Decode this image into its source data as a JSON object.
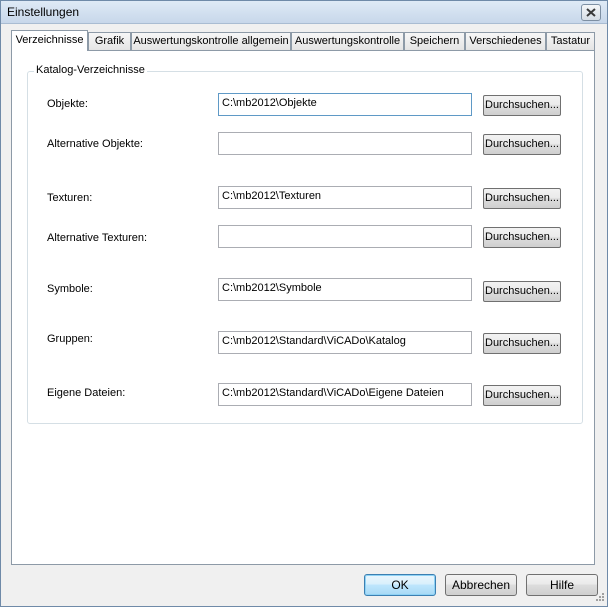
{
  "window": {
    "title": "Einstellungen"
  },
  "tabs": [
    {
      "label": "Verzeichnisse",
      "active": true
    },
    {
      "label": "Grafik",
      "active": false
    },
    {
      "label": "Auswertungskontrolle allgemein",
      "active": false
    },
    {
      "label": "Auswertungskontrolle",
      "active": false
    },
    {
      "label": "Speichern",
      "active": false
    },
    {
      "label": "Verschiedenes",
      "active": false
    },
    {
      "label": "Tastatur",
      "active": false
    }
  ],
  "group": {
    "title": "Katalog-Verzeichnisse",
    "rows": [
      {
        "label": "Objekte:",
        "value": "C:\\mb2012\\Objekte",
        "button": "Durchsuchen..."
      },
      {
        "label": "Alternative Objekte:",
        "value": "",
        "button": "Durchsuchen..."
      },
      {
        "label": "Texturen:",
        "value": "C:\\mb2012\\Texturen",
        "button": "Durchsuchen..."
      },
      {
        "label": "Alternative Texturen:",
        "value": "",
        "button": "Durchsuchen..."
      },
      {
        "label": "Symbole:",
        "value": "C:\\mb2012\\Symbole",
        "button": "Durchsuchen..."
      },
      {
        "label": "Gruppen:",
        "value": "C:\\mb2012\\Standard\\ViCADo\\Katalog",
        "button": "Durchsuchen..."
      },
      {
        "label": "Eigene Dateien:",
        "value": "C:\\mb2012\\Standard\\ViCADo\\Eigene Dateien",
        "button": "Durchsuchen..."
      }
    ]
  },
  "footer": {
    "ok_label": "OK",
    "cancel_label": "Abbrechen",
    "help_label": "Hilfe"
  },
  "icons": {
    "close": "close-icon",
    "resize": "resize-grip-icon"
  },
  "colors": {
    "default_button_border": "#3c7fb1",
    "focused_field_border": "#5f99c6"
  }
}
